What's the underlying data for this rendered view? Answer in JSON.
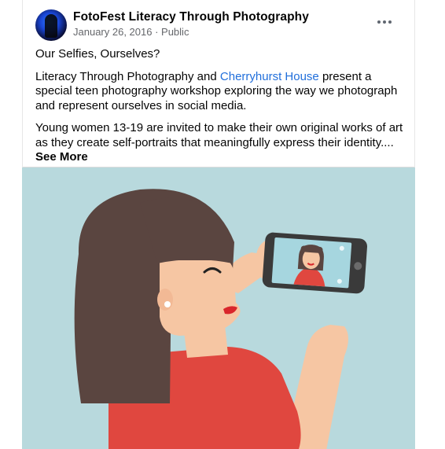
{
  "post": {
    "page_name": "FotoFest Literacy Through Photography",
    "date": "January 26, 2016",
    "separator": " · ",
    "audience": "Public",
    "title_line": "Our Selfies, Ourselves?",
    "p1_before": "Literacy Through Photography and ",
    "p1_link": "Cherryhurst House",
    "p1_after": " present a special teen photography workshop exploring the way we photograph and represent ourselves in social media.",
    "p2_text": "Young women 13-19 are invited to make their own original works of art as they create self-portraits that meaningfully express their identity.... ",
    "see_more": "See More"
  },
  "icons": {
    "avatar": "page-profile-avatar",
    "more": "more-options-icon"
  },
  "illustration": {
    "subject": "woman-taking-selfie-with-phone",
    "background_color": "#b8d9dd",
    "hair_color": "#5a4540",
    "shirt_color": "#e0473f",
    "skin_color": "#f6c6a3",
    "lip_color": "#d9262b",
    "phone_color": "#3a3a3a",
    "screen_color": "#a6d6df"
  }
}
